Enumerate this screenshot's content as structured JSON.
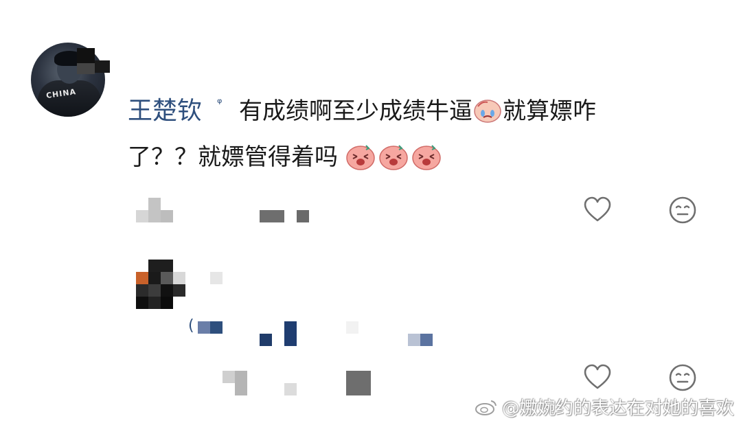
{
  "comment": {
    "username": "王楚钦",
    "verified_mark": "ᵠ",
    "text_line1": "有成绩啊至少成绩牛逼",
    "text_line1_tail": "就算嫖咋",
    "text_line2": "了？？就嫖管得着吗"
  },
  "reply": {
    "prefix": "("
  },
  "icons": {
    "like": "heart-icon",
    "dislike": "neutral-face-icon",
    "cry_emoji": "crying-face-emoji",
    "angry_emoji": "angry-pig-emoji"
  },
  "watermark": {
    "text": "@嫐婉约的表达在对她的喜欢"
  },
  "colors": {
    "username": "#2e4f7d",
    "text": "#1a1a1a",
    "icon": "#6f6f6f"
  }
}
